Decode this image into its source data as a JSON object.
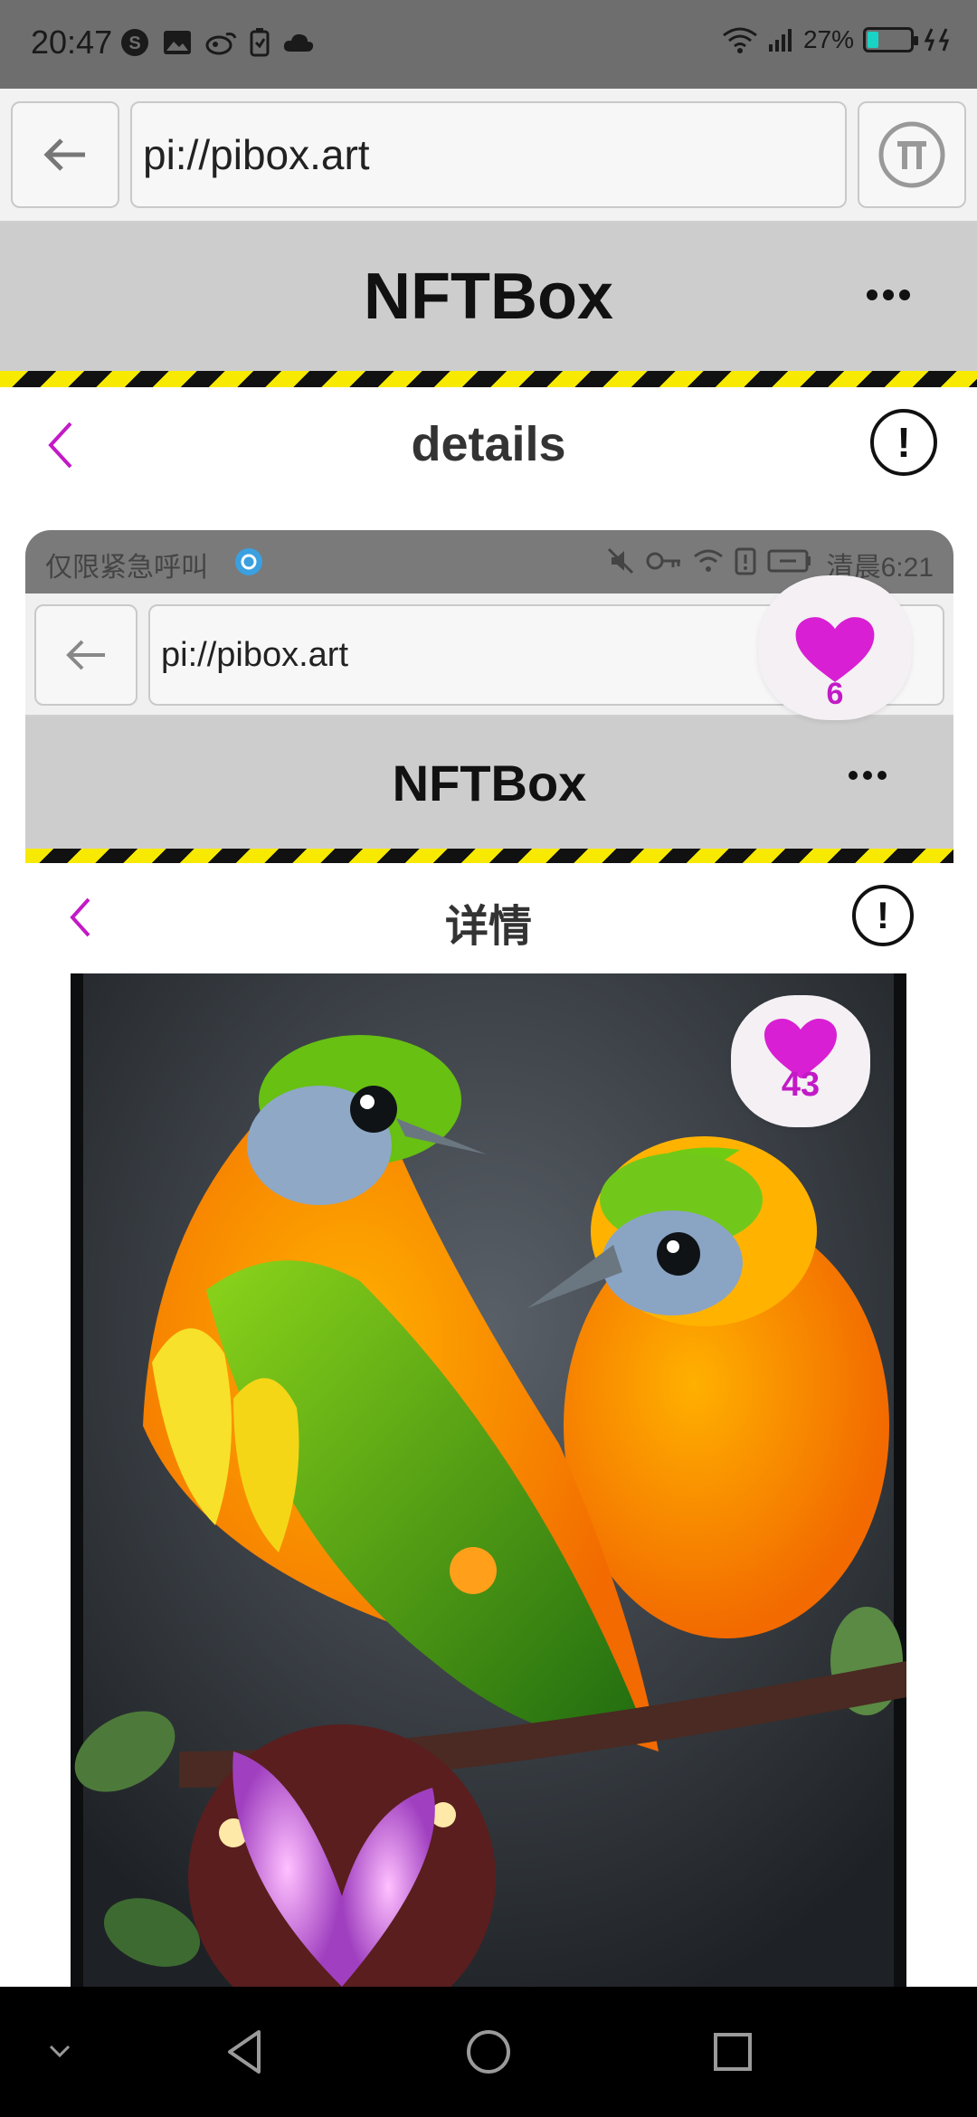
{
  "status_bar": {
    "time": "20:47",
    "battery_percent": "27%",
    "battery_level": 0.27,
    "icons": [
      "s-coin-icon",
      "image-icon",
      "bird-app-icon",
      "battery-saver-icon",
      "cloud-icon"
    ],
    "right_icons": [
      "wifi-icon",
      "signal-icon",
      "battery-icon",
      "charging-icon"
    ]
  },
  "browser": {
    "url": "pi://pibox.art",
    "back_icon": "arrow-left-icon",
    "pi_icon": "pi-logo-icon"
  },
  "app": {
    "title": "NFTBox",
    "menu_icon": "more-dots-icon"
  },
  "page": {
    "title": "details",
    "back_icon": "chevron-left-icon",
    "info_icon": "exclamation-circle-icon"
  },
  "nested_screenshot": {
    "status_left": "仅限紧急呼叫",
    "status_right": "清晨6:21",
    "url": "pi://pibox.art",
    "app_title": "NFTBox",
    "page_title": "详情"
  },
  "likes": {
    "outer_count": "6",
    "inner_count": "43",
    "color": "#d81fd3"
  },
  "colors": {
    "accent_purple": "#c21ac6",
    "header_gray": "#cdcdcd",
    "stripe_yellow": "#f7ea00",
    "status_gray": "#6e6e6e"
  },
  "artwork": {
    "subject_icon": "artwork-two-birds-image"
  },
  "navbar": {
    "icons": [
      "collapse-chevron-icon",
      "back-triangle-icon",
      "home-circle-icon",
      "recents-square-icon"
    ]
  }
}
